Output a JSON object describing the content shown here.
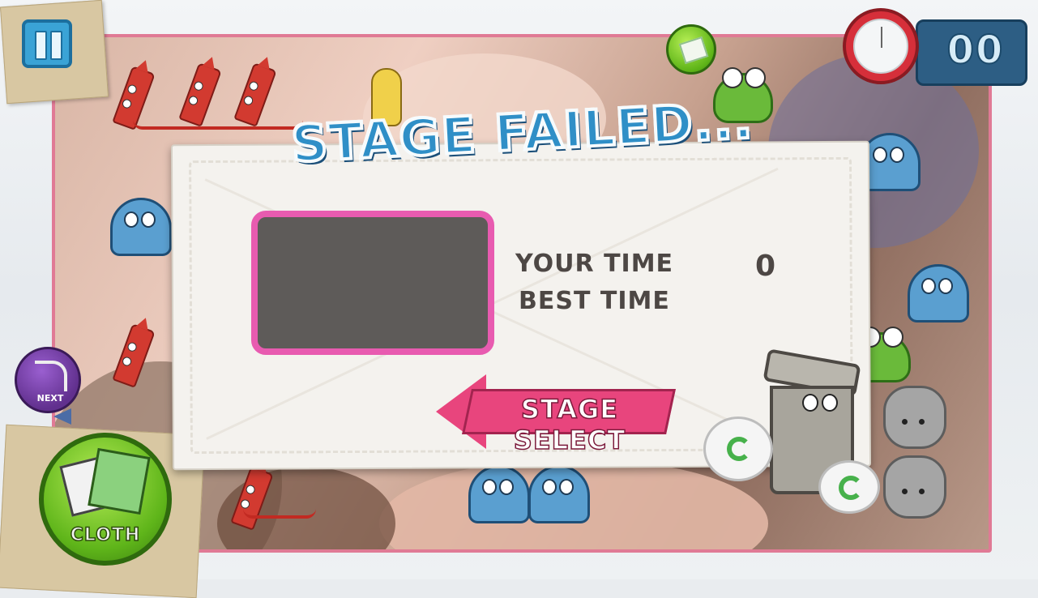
{
  "hud": {
    "timer_value": "00",
    "pause_icon": "pause-icon",
    "clock_icon": "stopwatch-icon",
    "money_icon": "cash-icon"
  },
  "modal": {
    "title": "STAGE FAILED...",
    "your_time_label": "YOUR TIME",
    "best_time_label": "BEST TIME",
    "your_time_value": "0",
    "best_time_value": "",
    "stage_select_label": "STAGE SELECT"
  },
  "tools": {
    "next_label": "NEXT",
    "cloth_label": "CLOTH"
  },
  "colors": {
    "title_blue": "#2f8fc7",
    "preview_border_pink": "#e85bb0",
    "button_pink": "#e8457d",
    "cloth_green": "#5fb51a",
    "timer_panel": "#2d5e84"
  }
}
